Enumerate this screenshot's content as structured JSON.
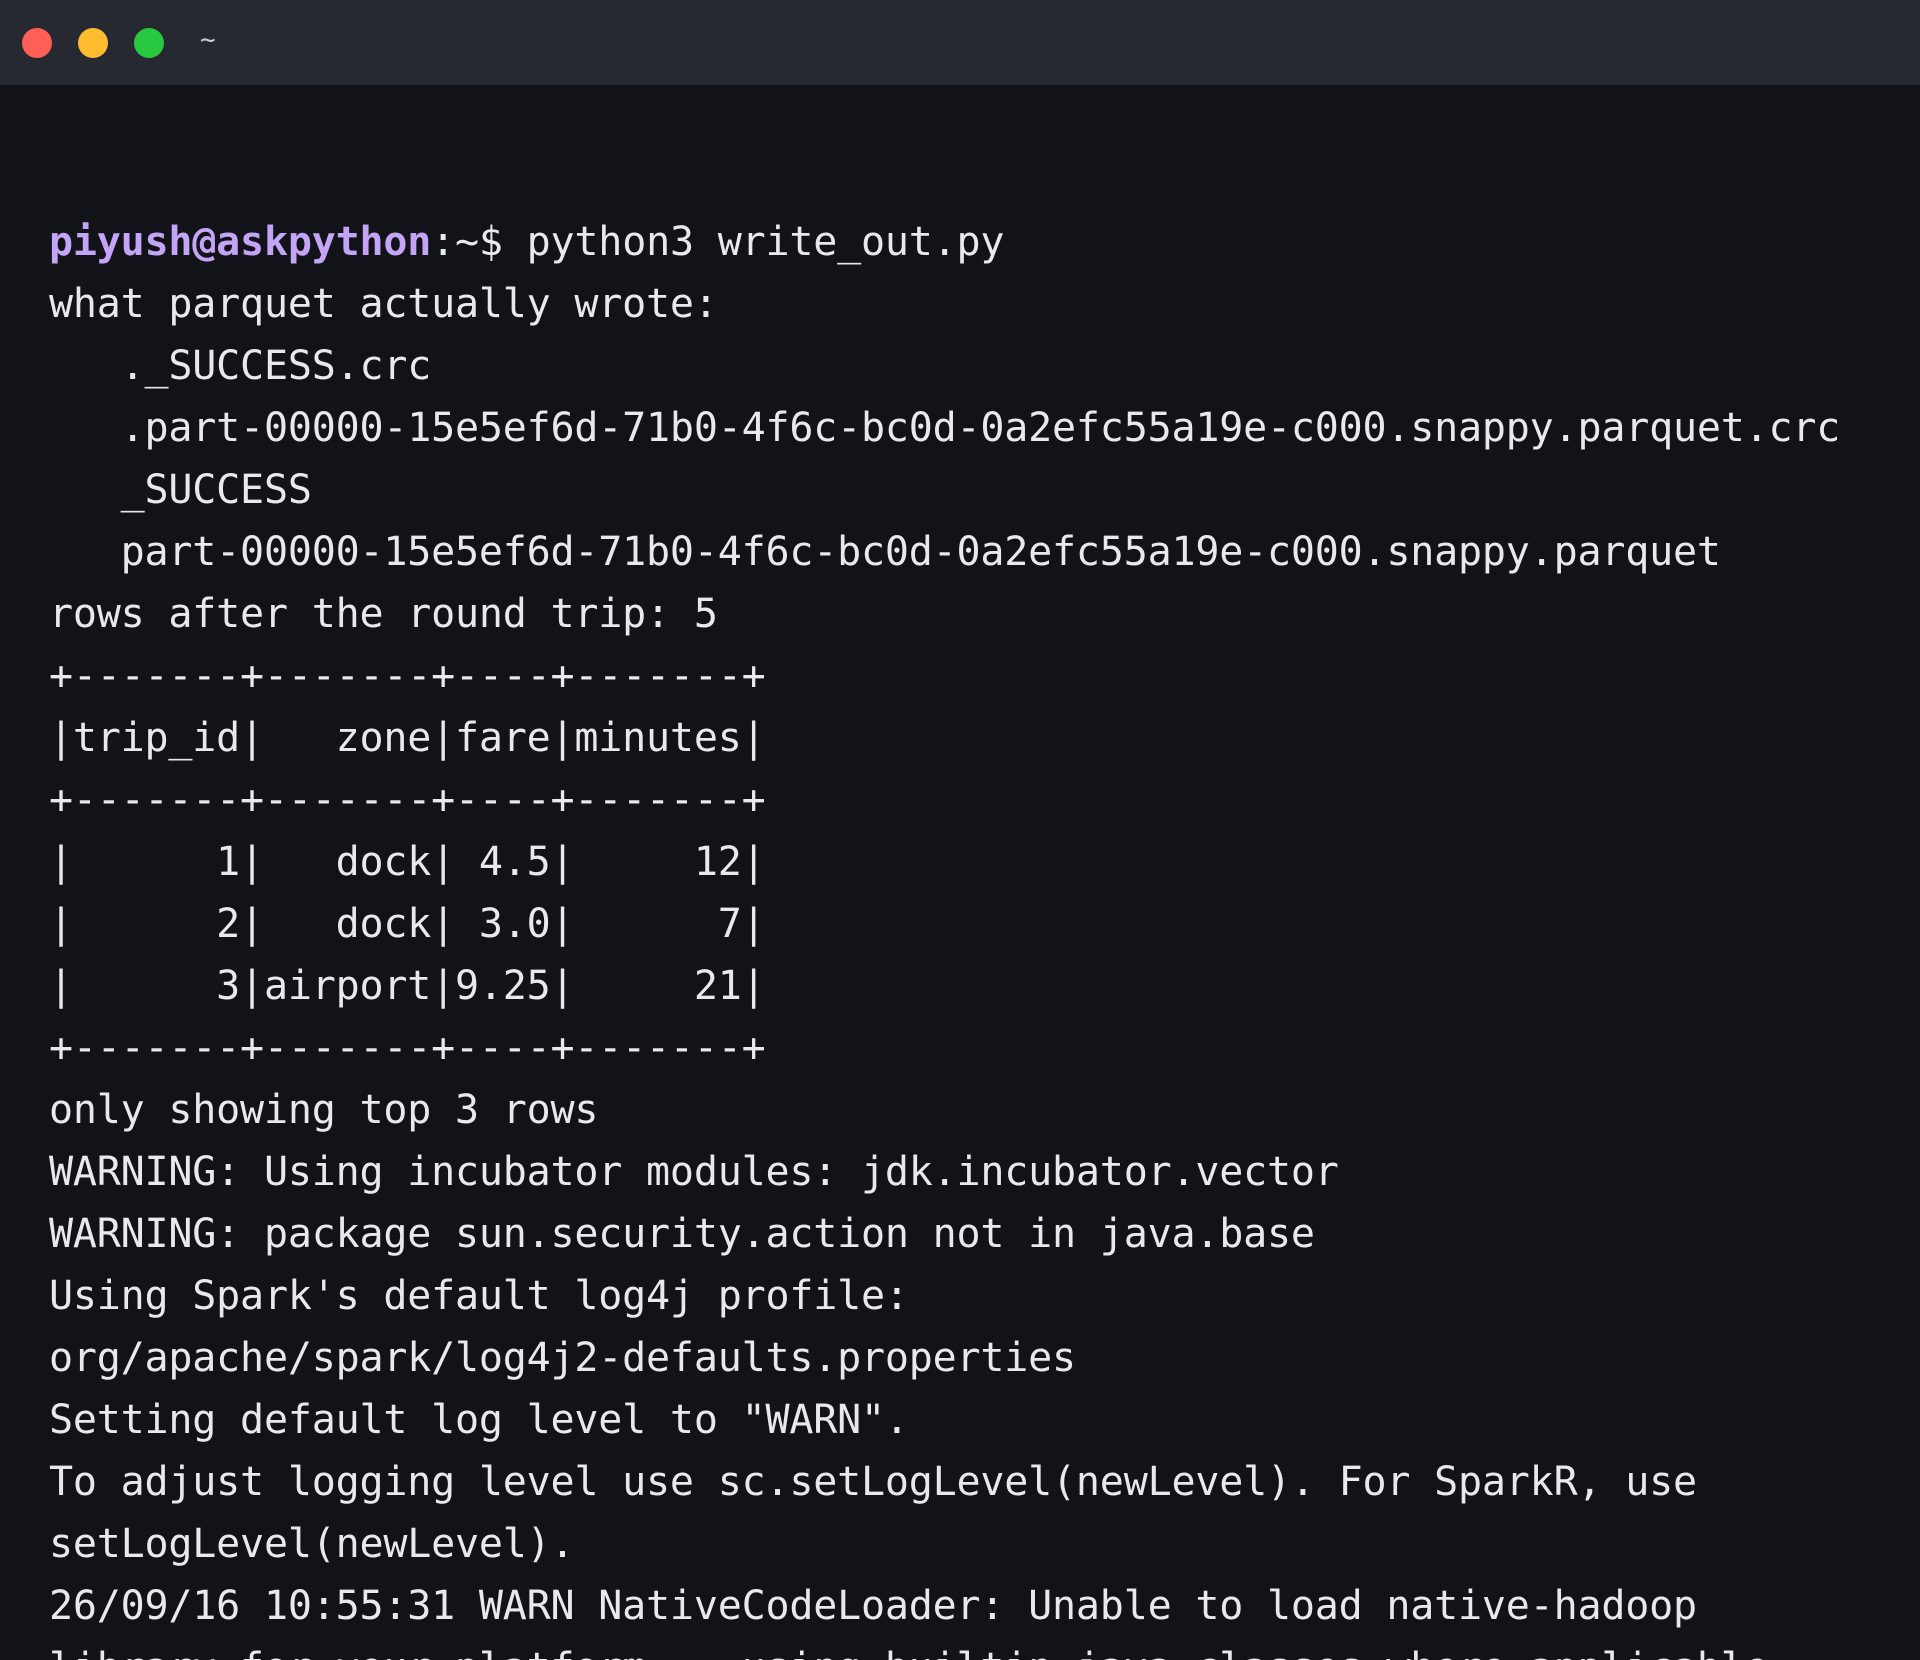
{
  "window": {
    "title": "~",
    "colors": {
      "close": "#fe5f57",
      "minimize": "#febc2e",
      "maximize": "#28c840",
      "background": "#121318",
      "titlebar": "#272931",
      "prompt_user": "#c4a4f6"
    }
  },
  "prompt": {
    "user_host": "piyush@askpython",
    "path_symbol": ":~$",
    "command": " python3 write_out.py"
  },
  "output_lines": [
    "what parquet actually wrote:",
    "   ._SUCCESS.crc",
    "   .part-00000-15e5ef6d-71b0-4f6c-bc0d-0a2efc55a19e-c000.snappy.parquet.crc",
    "   _SUCCESS",
    "   part-00000-15e5ef6d-71b0-4f6c-bc0d-0a2efc55a19e-c000.snappy.parquet",
    "rows after the round trip: 5",
    "+-------+-------+----+-------+",
    "|trip_id|   zone|fare|minutes|",
    "+-------+-------+----+-------+",
    "|      1|   dock| 4.5|     12|",
    "|      2|   dock| 3.0|      7|",
    "|      3|airport|9.25|     21|",
    "+-------+-------+----+-------+",
    "only showing top 3 rows",
    "WARNING: Using incubator modules: jdk.incubator.vector",
    "WARNING: package sun.security.action not in java.base",
    "Using Spark's default log4j profile:",
    "org/apache/spark/log4j2-defaults.properties",
    "Setting default log level to \"WARN\".",
    "To adjust logging level use sc.setLogLevel(newLevel). For SparkR, use",
    "setLogLevel(newLevel).",
    "26/09/16 10:55:31 WARN NativeCodeLoader: Unable to load native-hadoop",
    "library for your platform... using builtin-java classes where applicable"
  ]
}
